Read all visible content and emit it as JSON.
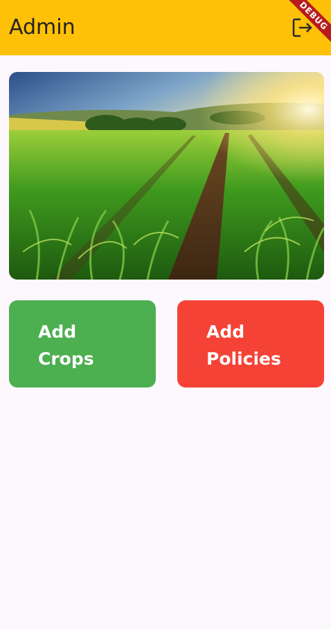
{
  "appbar": {
    "title": "Admin",
    "logout_icon": "logout-icon",
    "debug_label": "DEBUG",
    "background": "#ffc107"
  },
  "hero": {
    "image": "corn-field-landscape"
  },
  "actions": [
    {
      "label": "Add\nCrops",
      "color": "#4caf50"
    },
    {
      "label": "Add\nPolicies",
      "color": "#f44336"
    }
  ]
}
